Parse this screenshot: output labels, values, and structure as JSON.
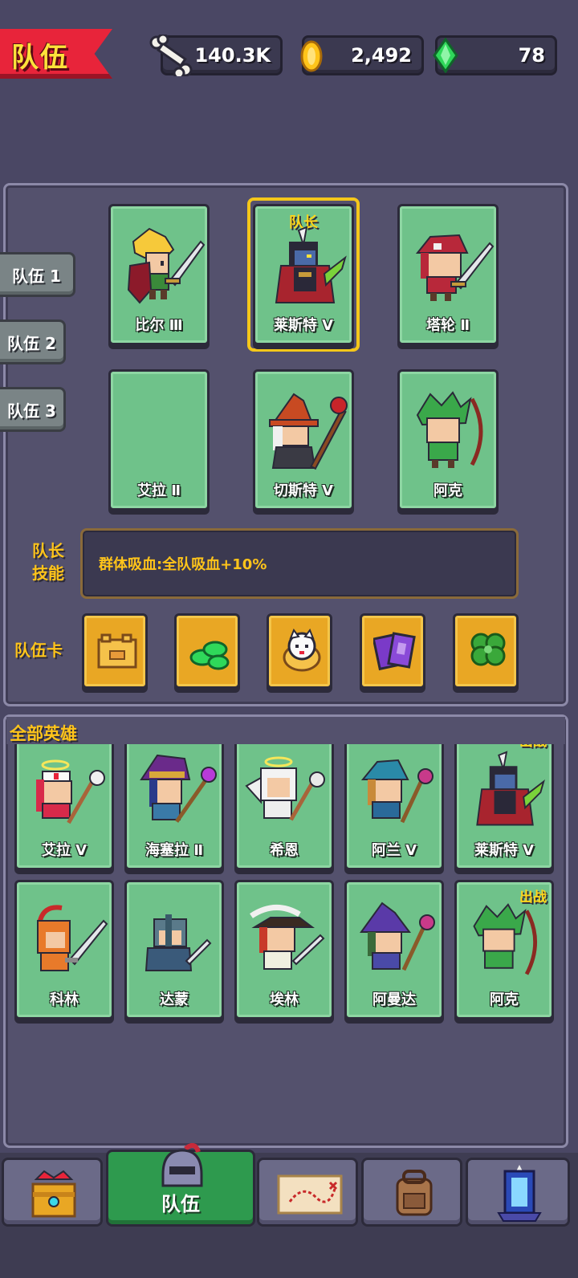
{
  "header": {
    "title": "队伍",
    "currencies": [
      {
        "icon": "bone-icon",
        "value": "140.3K"
      },
      {
        "icon": "gold-coin-icon",
        "value": "2,492"
      },
      {
        "icon": "green-gem-icon",
        "value": "78"
      }
    ]
  },
  "team_tabs": [
    "队伍 1",
    "队伍 2",
    "队伍 3"
  ],
  "captain_label": "队长",
  "team_slots": [
    {
      "name": "比尔 Ⅲ",
      "icon": "knight-sword-shield-icon"
    },
    {
      "name": "莱斯特 Ⅴ",
      "icon": "dark-knight-icon",
      "captain": true
    },
    {
      "name": "塔轮 Ⅱ",
      "icon": "red-hat-swordsman-icon"
    },
    {
      "name": "艾拉 Ⅱ",
      "icon": "empty-slot"
    },
    {
      "name": "切斯特 Ⅴ",
      "icon": "red-wizard-icon"
    },
    {
      "name": "阿克",
      "icon": "green-archer-icon"
    }
  ],
  "skill": {
    "label_line1": "队长",
    "label_line2": "技能",
    "text": "群体吸血:全队吸血+10%"
  },
  "team_cards_label": "队伍卡",
  "team_cards": [
    "piggy-bank-icon",
    "green-gems-icon",
    "lucky-cat-icon",
    "tarot-cards-icon",
    "clover-icon"
  ],
  "all_heroes": {
    "title": "全部英雄",
    "deployed_label": "出战",
    "row1": [
      {
        "name": "艾拉 Ⅴ",
        "icon": "nurse-healer-icon"
      },
      {
        "name": "海塞拉 Ⅱ",
        "icon": "purple-witch-icon"
      },
      {
        "name": "希恩",
        "icon": "angel-cleric-icon"
      },
      {
        "name": "阿兰 Ⅴ",
        "icon": "blue-mage-icon"
      },
      {
        "name": "莱斯特 Ⅴ",
        "icon": "dark-knight-icon",
        "deployed": true
      }
    ],
    "row2": [
      {
        "name": "科林",
        "icon": "spartan-warrior-icon"
      },
      {
        "name": "达蒙",
        "icon": "helmet-knight-icon"
      },
      {
        "name": "埃林",
        "icon": "pirate-swordsman-icon"
      },
      {
        "name": "阿曼达",
        "icon": "purple-wizard-icon"
      },
      {
        "name": "阿克",
        "icon": "green-archer-icon",
        "deployed": true
      }
    ]
  },
  "bottom_nav": [
    {
      "icon": "treasure-chest-icon",
      "label": ""
    },
    {
      "icon": "helmet-icon",
      "label": "队伍",
      "active": true
    },
    {
      "icon": "treasure-map-icon",
      "label": ""
    },
    {
      "icon": "backpack-icon",
      "label": ""
    },
    {
      "icon": "crystal-tower-icon",
      "label": ""
    }
  ],
  "colors": {
    "background": "#4a4764",
    "card_green": "#6fc28a",
    "gold_text": "#ffc41a",
    "banner_red": "#e8243a",
    "active_nav": "#2e9a4e"
  }
}
